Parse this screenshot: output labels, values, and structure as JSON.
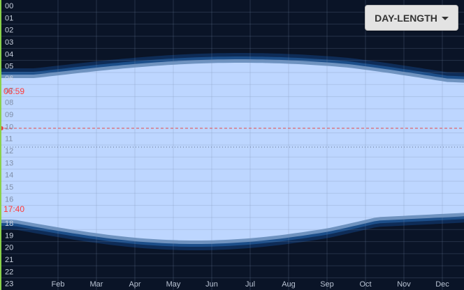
{
  "mode_dropdown": {
    "label": "DAY-LENGTH",
    "icon": "caret-down-icon"
  },
  "hour_labels": [
    "00",
    "01",
    "02",
    "03",
    "04",
    "05",
    "06",
    "07",
    "08",
    "09",
    "10",
    "11",
    "12",
    "13",
    "14",
    "15",
    "16",
    "17",
    "18",
    "19",
    "20",
    "21",
    "22",
    "23"
  ],
  "month_labels": [
    "Feb",
    "Mar",
    "Apr",
    "May",
    "Jun",
    "Jul",
    "Aug",
    "Sep",
    "Oct",
    "Nov",
    "Dec"
  ],
  "sunrise_label": "06:59",
  "sunset_label": "17:40",
  "colors": {
    "night": "#0a1427",
    "twilight_astronomical": "#0e2c57",
    "twilight_nautical": "#1d4f8a",
    "twilight_civil": "#6f93c0",
    "day": "#bdd6ff",
    "current_time_line": "#e24a4a",
    "accent_red": "#ff3b3b",
    "day_start_bar": "#8ad24a"
  }
}
